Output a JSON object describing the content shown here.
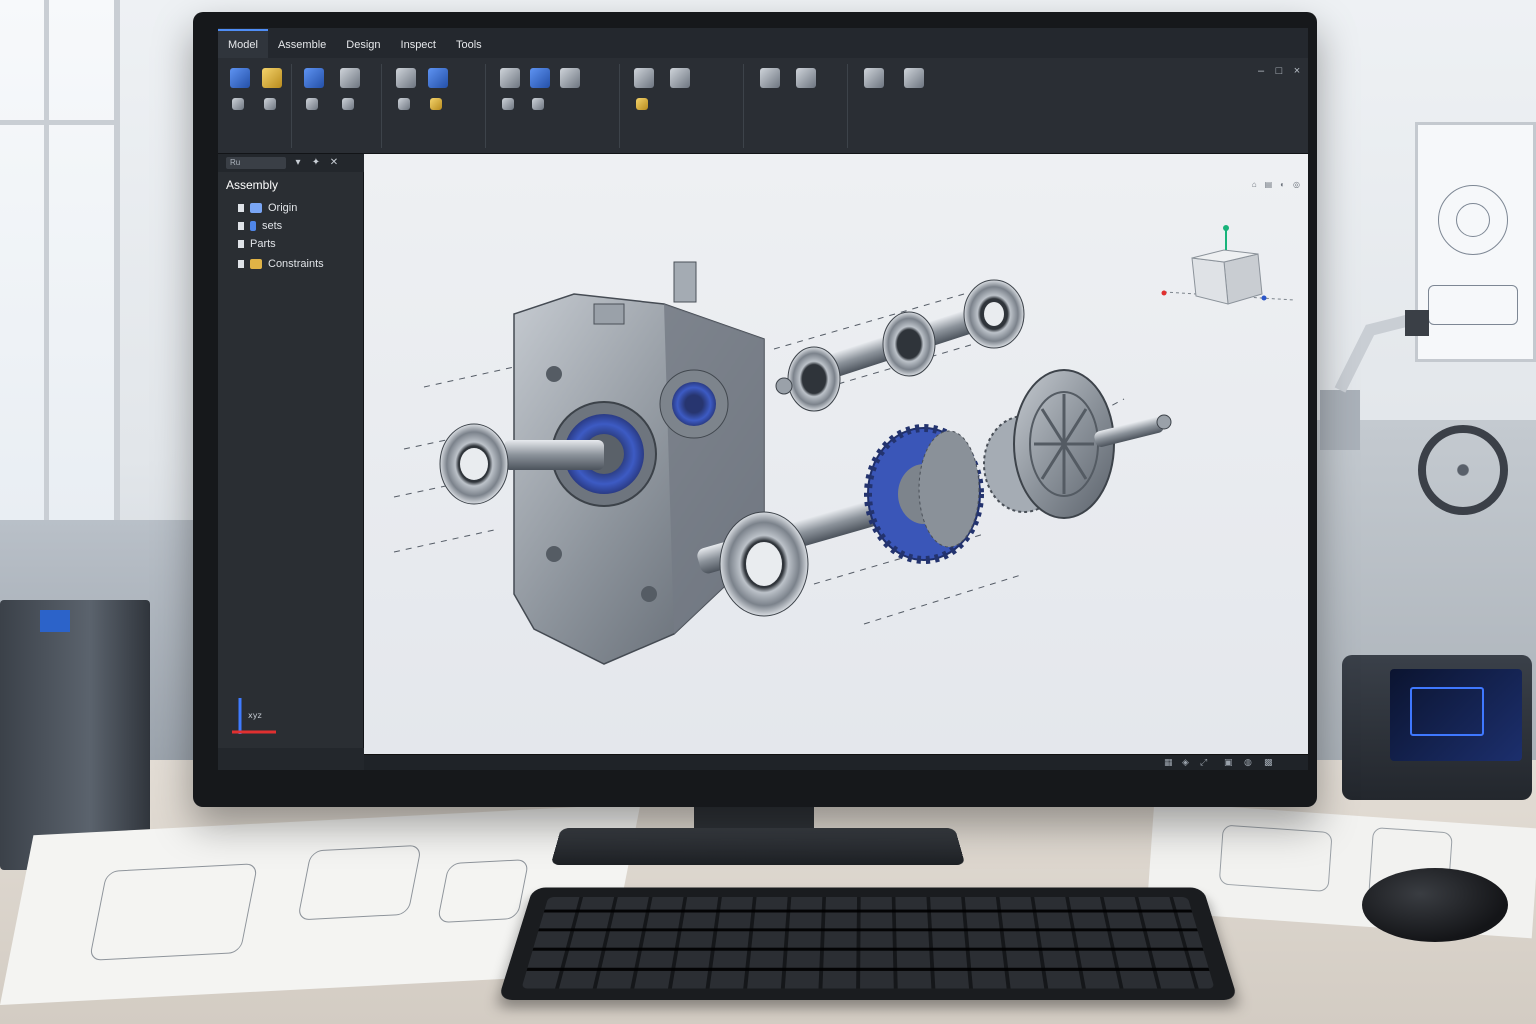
{
  "ribbon": {
    "tabs": [
      "Model",
      "Assemble",
      "Design",
      "Inspect",
      "Tools"
    ],
    "active_tab": "Model"
  },
  "browser": {
    "search_placeholder": "Ru",
    "header": "Assembly",
    "items": [
      {
        "label": "Origin",
        "icon": "folder-icon"
      },
      {
        "label": "sets",
        "icon": "bullet-icon"
      },
      {
        "label": "Parts",
        "icon": "bullet-icon"
      },
      {
        "label": "Constraints",
        "icon": "constraint-icon"
      }
    ]
  },
  "viewport": {
    "header_items": [
      "Home",
      "View",
      "Display"
    ],
    "view_cube": "view-cube"
  },
  "colors": {
    "accent_blue": "#3a56b8",
    "housing_grey": "#8a9099",
    "bg_viewport": "#e9ecf0",
    "ui_dark": "#24282e"
  }
}
